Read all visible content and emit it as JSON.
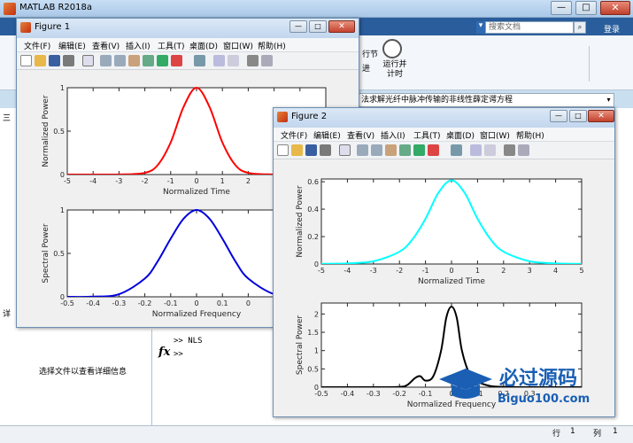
{
  "app": {
    "title": "MATLAB R2018a",
    "search_placeholder": "搜索文档",
    "login": "登录",
    "minimize": "—",
    "maximize": "□",
    "close": "✕",
    "ribbon": {
      "label1": "行节",
      "label2": "进",
      "run_and_time": "运行并\n计时"
    },
    "address_text": "法求解光纤中脉冲传输的非线性薛定谔方程",
    "left_label_top": "三",
    "left_label_bottom": "详",
    "detail_text": "选择文件以查看详细信息",
    "command": {
      "history": ">> NLS",
      "fx": "fx",
      "prompt": ">>"
    },
    "status": {
      "row_label": "行",
      "row": "1",
      "col_label": "列",
      "col": "1"
    }
  },
  "menu_items": [
    "文件(F)",
    "编辑(E)",
    "查看(V)",
    "插入(I)",
    "工具(T)",
    "桌面(D)",
    "窗口(W)",
    "帮助(H)"
  ],
  "figures": [
    {
      "title": "Figure 1",
      "minimize": "—",
      "maximize": "□",
      "close": "✕",
      "axes": [
        {
          "xlabel": "Normalized Time",
          "ylabel": "Normalized Power",
          "color": "#ff0000",
          "xlim": [
            -5,
            5
          ],
          "ylim": [
            0,
            1
          ],
          "xticks_visible": [
            "-5",
            "-4",
            "-3",
            "-2",
            "-1",
            "0",
            "1",
            "2"
          ],
          "yticks": [
            "0",
            "0.5",
            "1"
          ]
        },
        {
          "xlabel": "Normalized Frequency",
          "ylabel": "Spectral Power",
          "color": "#0000dd",
          "xlim": [
            -0.5,
            0.5
          ],
          "ylim": [
            0,
            1
          ],
          "xticks_visible": [
            "-0.5",
            "-0.4",
            "-0.3",
            "-0.2",
            "-0.1",
            "0",
            "0.1",
            "0"
          ],
          "yticks": [
            "0",
            "0.5",
            "1"
          ]
        }
      ]
    },
    {
      "title": "Figure 2",
      "minimize": "—",
      "maximize": "□",
      "close": "✕",
      "axes": [
        {
          "xlabel": "Normalized Time",
          "ylabel": "Normalized Power",
          "color": "#00ffff",
          "xlim": [
            -5,
            5
          ],
          "ylim": [
            0,
            0.62
          ],
          "xticks": [
            "-5",
            "-4",
            "-3",
            "-2",
            "-1",
            "0",
            "1",
            "2",
            "3",
            "4",
            "5"
          ],
          "yticks": [
            "0",
            "0.2",
            "0.4",
            "0.6"
          ]
        },
        {
          "xlabel": "Normalized Frequency",
          "ylabel": "Spectral Power",
          "color": "#000000",
          "xlim": [
            -0.5,
            0.5
          ],
          "ylim": [
            0,
            2.3
          ],
          "xticks_visible": [
            "-0.5",
            "-0.4",
            "-0.3",
            "-0.2",
            "-0.1",
            "0",
            "0.1",
            "0.2",
            "0.3"
          ],
          "yticks": [
            "0",
            "0.5",
            "1",
            "1.5",
            "2"
          ]
        }
      ]
    }
  ],
  "chart_data": [
    {
      "type": "line",
      "xlabel": "Normalized Time",
      "ylabel": "Normalized Power",
      "xlim": [
        -5,
        5
      ],
      "ylim": [
        0,
        1
      ],
      "series": [
        {
          "color": "#ff0000",
          "x": [
            -5,
            -4,
            -3,
            -2,
            -1.5,
            -1,
            -0.5,
            0,
            0.5,
            1,
            1.5,
            2,
            3,
            4,
            5
          ],
          "y": [
            0,
            0,
            0.001,
            0.02,
            0.11,
            0.37,
            0.78,
            1,
            0.78,
            0.37,
            0.11,
            0.02,
            0.001,
            0,
            0
          ]
        }
      ]
    },
    {
      "type": "line",
      "xlabel": "Normalized Frequency",
      "ylabel": "Spectral Power",
      "xlim": [
        -0.5,
        0.5
      ],
      "ylim": [
        0,
        1
      ],
      "series": [
        {
          "color": "#0000dd",
          "x": [
            -0.5,
            -0.4,
            -0.3,
            -0.2,
            -0.15,
            -0.1,
            -0.05,
            0,
            0.05,
            0.1,
            0.15,
            0.2,
            0.3,
            0.4,
            0.5
          ],
          "y": [
            0,
            0.002,
            0.03,
            0.21,
            0.41,
            0.67,
            0.9,
            1,
            0.9,
            0.67,
            0.41,
            0.21,
            0.03,
            0.002,
            0
          ]
        }
      ]
    },
    {
      "type": "line",
      "xlabel": "Normalized Time",
      "ylabel": "Normalized Power",
      "xlim": [
        -5,
        5
      ],
      "ylim": [
        0,
        0.62
      ],
      "series": [
        {
          "color": "#00ffff",
          "x": [
            -5,
            -4,
            -3,
            -2,
            -1.5,
            -1,
            -0.5,
            0,
            0.5,
            1,
            1.5,
            2,
            3,
            4,
            5
          ],
          "y": [
            0.001,
            0.005,
            0.02,
            0.09,
            0.18,
            0.33,
            0.52,
            0.61,
            0.52,
            0.33,
            0.18,
            0.09,
            0.02,
            0.005,
            0.001
          ]
        }
      ]
    },
    {
      "type": "line",
      "xlabel": "Normalized Frequency",
      "ylabel": "Spectral Power",
      "xlim": [
        -0.5,
        0.5
      ],
      "ylim": [
        0,
        2.3
      ],
      "series": [
        {
          "color": "#000000",
          "x": [
            -0.5,
            -0.3,
            -0.2,
            -0.17,
            -0.14,
            -0.12,
            -0.1,
            -0.07,
            -0.04,
            -0.02,
            0,
            0.02,
            0.04,
            0.07,
            0.1,
            0.15,
            0.2,
            0.3,
            0.5
          ],
          "y": [
            0,
            0,
            0.01,
            0.06,
            0.25,
            0.3,
            0.18,
            0.3,
            1.0,
            1.9,
            2.2,
            1.9,
            1.0,
            0.35,
            0.15,
            0.03,
            0.01,
            0,
            0
          ]
        }
      ]
    }
  ],
  "colors": {
    "title_bar": "#c2d6ee",
    "ribbon_tab": "#2a5d9b"
  }
}
